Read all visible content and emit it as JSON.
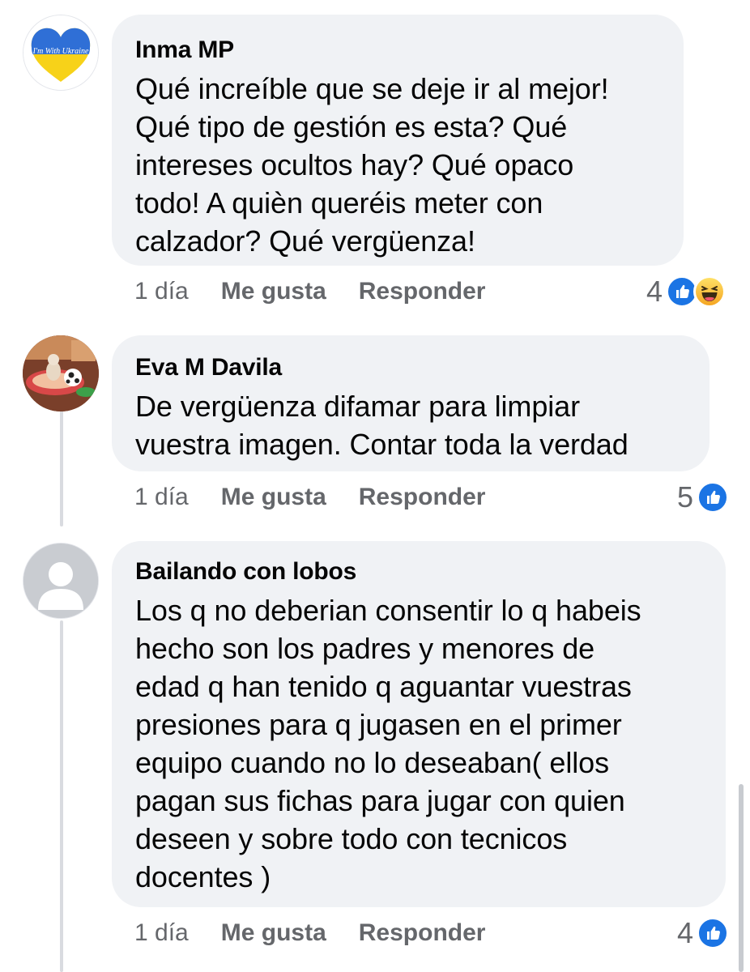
{
  "comments": [
    {
      "author": "Inma MP",
      "avatar_badge_text": "I'm With Ukraine",
      "text": "Qué increíble que se deje ir al mejor!\nQué tipo de gestión es esta? Qué\nintereses ocultos hay? Qué opaco\ntodo! A quièn queréis meter con\ncalzador? Qué vergüenza!",
      "time": "1 día",
      "like_label": "Me gusta",
      "reply_label": "Responder",
      "reaction_count": "4",
      "reaction_icons": [
        "like-icon",
        "haha-icon"
      ]
    },
    {
      "author": "Eva M Davila",
      "text": "De vergüenza difamar para limpiar\nvuestra imagen. Contar toda la verdad",
      "time": "1 día",
      "like_label": "Me gusta",
      "reply_label": "Responder",
      "reaction_count": "5",
      "reaction_icons": [
        "like-icon"
      ]
    },
    {
      "author": "Bailando con lobos",
      "text": "Los q no deberian consentir lo q habeis\nhecho son los padres y menores de\nedad q han tenido q aguantar vuestras\npresiones para q jugasen en el primer\nequipo cuando no lo deseaban( ellos\npagan sus fichas para jugar con quien\ndeseen y sobre todo con tecnicos\ndocentes )",
      "time": "1 día",
      "like_label": "Me gusta",
      "reply_label": "Responder",
      "reaction_count": "4",
      "reaction_icons": [
        "like-icon"
      ]
    }
  ],
  "colors": {
    "bubble_bg": "#f0f2f5",
    "meta_text": "#65676b",
    "like_blue": "#1b74e4",
    "thread_line": "#d9dbe0"
  }
}
